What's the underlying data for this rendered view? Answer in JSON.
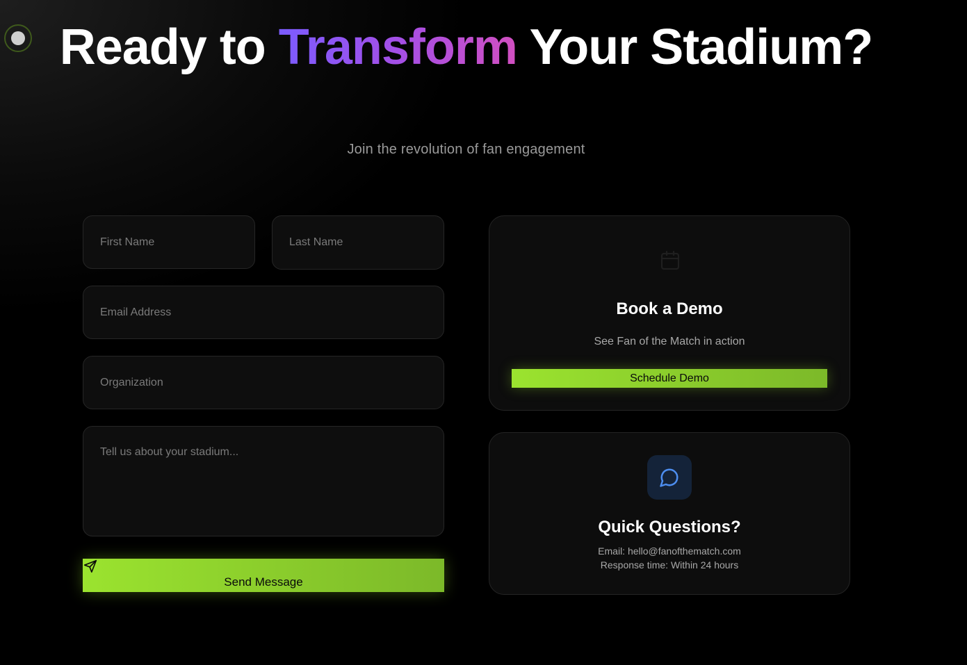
{
  "hero": {
    "title_part1": "Ready to ",
    "title_accent": "Transform",
    "title_part2": " Your Stadium?",
    "subtitle": "Join the revolution of fan engagement"
  },
  "form": {
    "first_name_placeholder": "First Name",
    "last_name_placeholder": "Last Name",
    "email_placeholder": "Email Address",
    "organization_placeholder": "Organization",
    "message_placeholder": "Tell us about your stadium...",
    "submit_label": "Send Message",
    "submit_icon": "send-icon"
  },
  "demo_card": {
    "icon": "calendar-icon",
    "title": "Book a Demo",
    "text": "See Fan of the Match in action",
    "button_label": "Schedule Demo"
  },
  "quick_card": {
    "icon": "chat-bubble-icon",
    "title": "Quick Questions?",
    "email_line": "Email: hello@fanofthematch.com",
    "response_line": "Response time: Within 24 hours"
  },
  "colors": {
    "accent_green": "#9be32f",
    "accent_purple": "#7b5cff",
    "accent_pink": "#d14fc0",
    "background": "#000000"
  }
}
